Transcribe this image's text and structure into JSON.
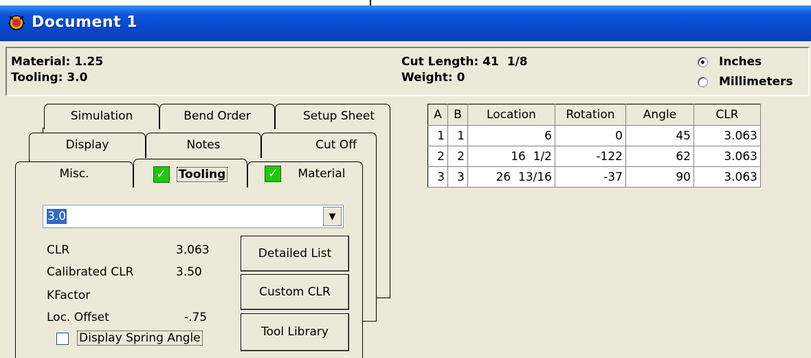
{
  "window": {
    "title": "Document 1",
    "icon": "app-bug-icon"
  },
  "info": {
    "material_label": "Material: 1.25",
    "tooling_label": "Tooling: 3.0",
    "cut_length_label": "Cut Length: 41  1/8",
    "weight_label": "Weight: 0",
    "units": {
      "inches": "Inches",
      "millimeters": "Millimeters",
      "selected": "Inches"
    }
  },
  "tabs": {
    "row1": [
      "Simulation",
      "Bend Order",
      "Setup Sheet"
    ],
    "row2": [
      "Display",
      "Notes",
      "Cut Off"
    ],
    "row3": [
      "Misc.",
      "Tooling",
      "Material"
    ],
    "active": "Tooling"
  },
  "tooling": {
    "combo_value": "3.0",
    "fields": [
      {
        "label": "CLR",
        "value": "3.063"
      },
      {
        "label": "Calibrated CLR",
        "value": "3.50"
      },
      {
        "label": "KFactor",
        "value": ""
      },
      {
        "label": "Loc. Offset",
        "value": "-.75"
      }
    ],
    "spring_checkbox": "Display Spring Angle",
    "buttons": {
      "detailed": "Detailed List",
      "custom": "Custom CLR",
      "library": "Tool Library"
    }
  },
  "grid": {
    "headers": [
      "A",
      "B",
      "Location",
      "Rotation",
      "Angle",
      "CLR"
    ],
    "rows": [
      [
        "1",
        "1",
        "6",
        "0",
        "45",
        "3.063"
      ],
      [
        "2",
        "2",
        "16  1/2",
        "-122",
        "62",
        "3.063"
      ],
      [
        "3",
        "3",
        "26  13/16",
        "-37",
        "90",
        "3.063"
      ]
    ]
  },
  "colors": {
    "titlebar": "#0a55dc",
    "check": "#1fc80d",
    "face": "#ece9d8"
  }
}
